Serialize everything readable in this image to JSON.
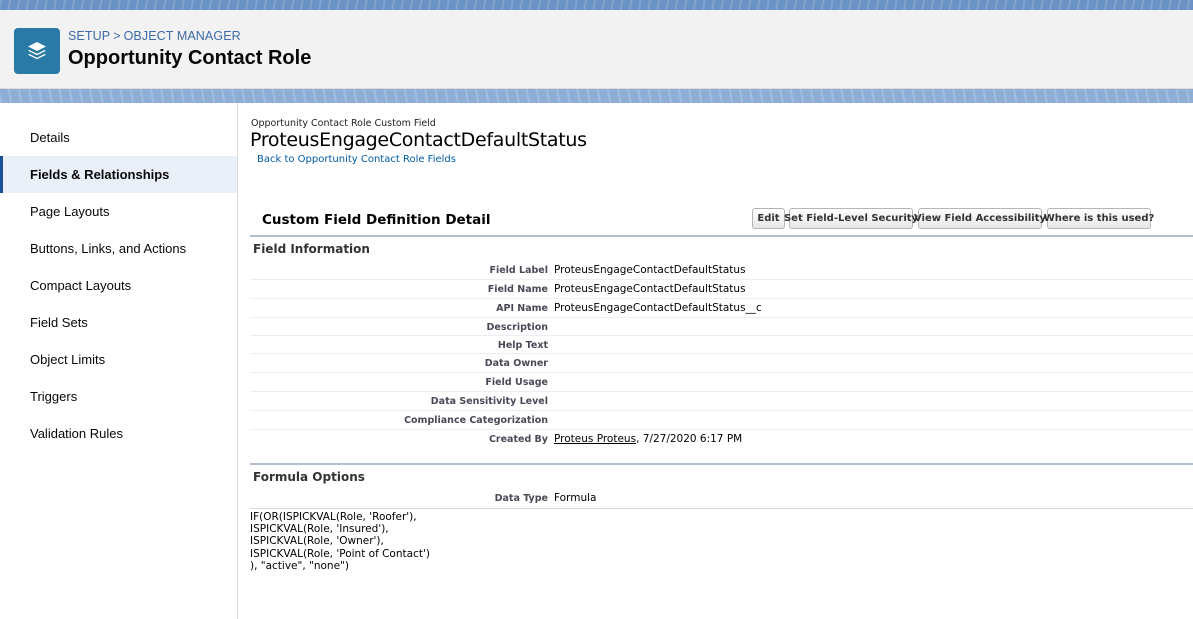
{
  "header": {
    "breadcrumb": [
      "SETUP",
      "OBJECT MANAGER"
    ],
    "breadcrumb_sep": ">",
    "title": "Opportunity Contact Role",
    "icon": "layers-icon"
  },
  "sidebar": {
    "items": [
      {
        "label": "Details"
      },
      {
        "label": "Fields & Relationships",
        "active": true
      },
      {
        "label": "Page Layouts"
      },
      {
        "label": "Buttons, Links, and Actions"
      },
      {
        "label": "Compact Layouts"
      },
      {
        "label": "Field Sets"
      },
      {
        "label": "Object Limits"
      },
      {
        "label": "Triggers"
      },
      {
        "label": "Validation Rules"
      }
    ]
  },
  "main": {
    "record_type_label": "Opportunity Contact Role Custom Field",
    "record_title": "ProteusEngageContactDefaultStatus",
    "back_link": "Back to Opportunity Contact Role Fields",
    "detail_title": "Custom Field Definition Detail",
    "buttons": {
      "edit": "Edit",
      "security": "Set Field-Level Security",
      "accessibility": "View Field Accessibility",
      "where_used": "Where is this used?"
    },
    "field_info": {
      "heading": "Field Information",
      "rows": [
        {
          "label": "Field Label",
          "value": "ProteusEngageContactDefaultStatus"
        },
        {
          "label": "Field Name",
          "value": "ProteusEngageContactDefaultStatus"
        },
        {
          "label": "API Name",
          "value": "ProteusEngageContactDefaultStatus__c"
        },
        {
          "label": "Description",
          "value": ""
        },
        {
          "label": "Help Text",
          "value": ""
        },
        {
          "label": "Data Owner",
          "value": ""
        },
        {
          "label": "Field Usage",
          "value": ""
        },
        {
          "label": "Data Sensitivity Level",
          "value": ""
        },
        {
          "label": "Compliance Categorization",
          "value": ""
        },
        {
          "label": "Created By",
          "value": "Proteus Proteus",
          "value_suffix": ", 7/27/2020 6:17 PM"
        }
      ]
    },
    "formula_options": {
      "heading": "Formula Options",
      "data_type_label": "Data Type",
      "data_type_value": "Formula",
      "formula": "IF(OR(ISPICKVAL(Role, 'Roofer'),\nISPICKVAL(Role, 'Insured'),\nISPICKVAL(Role, 'Owner'),\nISPICKVAL(Role, 'Point of Contact')\n), \"active\", \"none\")"
    }
  },
  "colors": {
    "header_bg": "#f3f2f2",
    "app_icon_bg": "#2a7aa8",
    "link": "#015ba7",
    "active_nav_bg": "#eaf0f8",
    "active_nav_bar": "#1b5297",
    "section_rule": "#b2bfd1"
  }
}
